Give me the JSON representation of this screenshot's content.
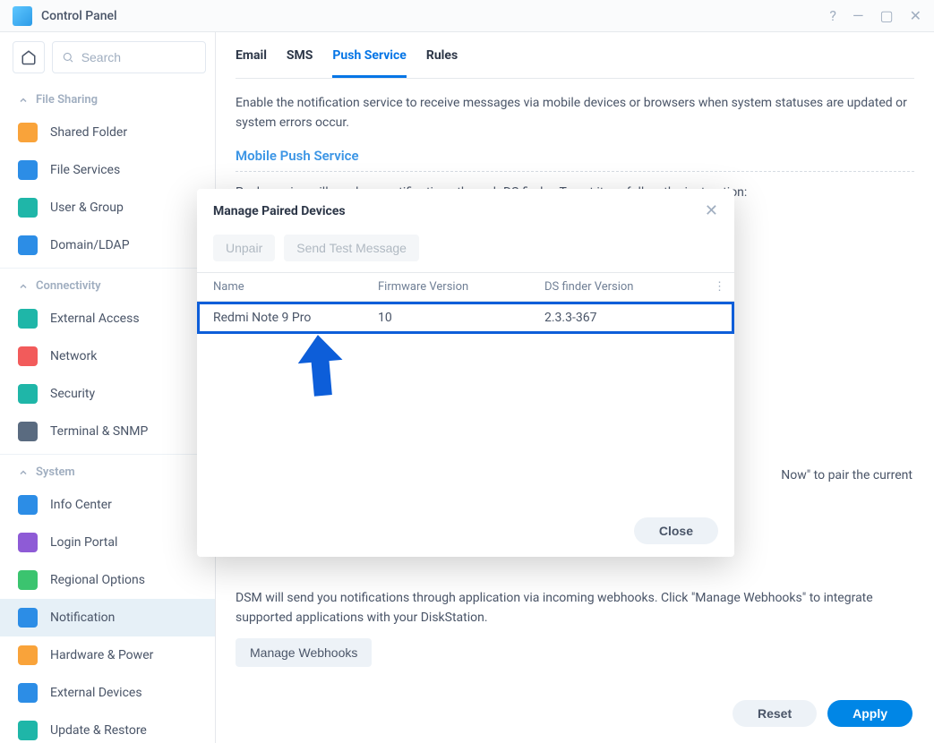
{
  "window": {
    "title": "Control Panel"
  },
  "search": {
    "placeholder": "Search"
  },
  "sidebar": {
    "sections": [
      {
        "label": "File Sharing",
        "items": [
          {
            "label": "Shared Folder",
            "color": "#f9a33a",
            "icon": "folder"
          },
          {
            "label": "File Services",
            "color": "#2c8de6",
            "icon": "file"
          },
          {
            "label": "User & Group",
            "color": "#1fb6a8",
            "icon": "users"
          },
          {
            "label": "Domain/LDAP",
            "color": "#2c8de6",
            "icon": "domain"
          }
        ]
      },
      {
        "label": "Connectivity",
        "items": [
          {
            "label": "External Access",
            "color": "#1fb6a8",
            "icon": "globe"
          },
          {
            "label": "Network",
            "color": "#f25b5b",
            "icon": "net"
          },
          {
            "label": "Security",
            "color": "#1fb6a8",
            "icon": "shield"
          },
          {
            "label": "Terminal & SNMP",
            "color": "#5a6b80",
            "icon": "terminal"
          }
        ]
      },
      {
        "label": "System",
        "items": [
          {
            "label": "Info Center",
            "color": "#2c8de6",
            "icon": "info"
          },
          {
            "label": "Login Portal",
            "color": "#8e5bd6",
            "icon": "portal"
          },
          {
            "label": "Regional Options",
            "color": "#3bc46f",
            "icon": "region"
          },
          {
            "label": "Notification",
            "color": "#2c8de6",
            "icon": "bell",
            "active": true
          },
          {
            "label": "Hardware & Power",
            "color": "#f9a33a",
            "icon": "bulb"
          },
          {
            "label": "External Devices",
            "color": "#2c8de6",
            "icon": "ext"
          },
          {
            "label": "Update & Restore",
            "color": "#1fb6a8",
            "icon": "update"
          }
        ]
      }
    ]
  },
  "tabs": [
    "Email",
    "SMS",
    "Push Service",
    "Rules"
  ],
  "active_tab": "Push Service",
  "content": {
    "intro": "Enable the notification service to receive messages via mobile devices or browsers when system statuses are updated or system errors occur.",
    "mobile_push_title": "Mobile Push Service",
    "push_desc": "Push service will send you notifications through DS finder. To set it up, follow the instruction:",
    "pair_hint_partial": "Now\" to pair the current",
    "webhook_desc": "DSM will send you notifications through application via incoming webhooks. Click \"Manage Webhooks\" to integrate supported applications with your DiskStation.",
    "manage_webhooks_btn": "Manage Webhooks"
  },
  "footer": {
    "reset": "Reset",
    "apply": "Apply"
  },
  "modal": {
    "title": "Manage Paired Devices",
    "unpair_btn": "Unpair",
    "test_btn": "Send Test Message",
    "columns": [
      "Name",
      "Firmware Version",
      "DS finder Version"
    ],
    "rows": [
      {
        "name": "Redmi Note 9 Pro",
        "firmware": "10",
        "dsf": "2.3.3-367"
      }
    ],
    "close_btn": "Close"
  }
}
